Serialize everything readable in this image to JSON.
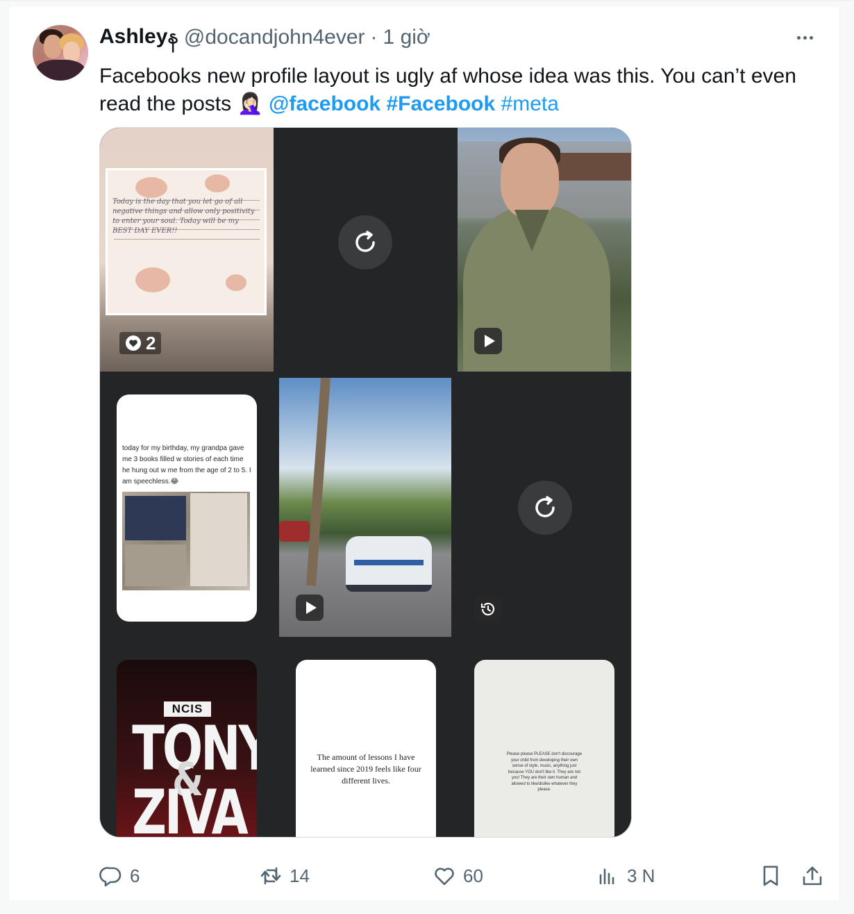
{
  "tweet": {
    "author_name": "Ashleyန",
    "author_handle": "@docandjohn4ever",
    "separator": "·",
    "time": "1 giờ",
    "text_main": "Facebooks new profile layout is ugly af whose idea was this. You can’t even read the posts 🤦🏻‍♀️ ",
    "mention": "@facebook",
    "hashtag_bold": "#Facebook",
    "hashtag": "#meta"
  },
  "media": {
    "post1": {
      "note": "Today is the day that you let go of all negative things and allow only positivity to enter your soul. Today will be my BEST DAY EVER!!",
      "like_count": "2"
    },
    "post4": {
      "caption": "today for my birthday, my grandpa gave me 3 books filled w stories of each time he hung out w me from the age of 2 to 5. I am speechless.😂"
    },
    "post7": {
      "label": "NCIS",
      "title_line1": "TONY",
      "title_amp": "&",
      "title_line2": "ZIVA"
    },
    "post8": {
      "text": "The amount of lessons I have learned since 2019 feels like four different lives."
    },
    "post9": {
      "text": "Please please PLEASE don't discourage your child from developing their own sense of style, music, anything just because YOU don't like it. They are not you! They are their own human and allowed to like/dislike whatever they please."
    }
  },
  "actions": {
    "replies": "6",
    "retweets": "14",
    "likes": "60",
    "views": "3 N"
  },
  "icons": [
    "more-icon",
    "refresh-icon",
    "play-icon",
    "history-icon",
    "heart-icon",
    "reply-icon",
    "retweet-icon",
    "like-icon",
    "views-icon",
    "bookmark-icon",
    "share-icon"
  ],
  "colors": {
    "link": "#1d9bf0",
    "muted": "#536471",
    "text": "#0f1419",
    "tile_bg": "#242526"
  }
}
